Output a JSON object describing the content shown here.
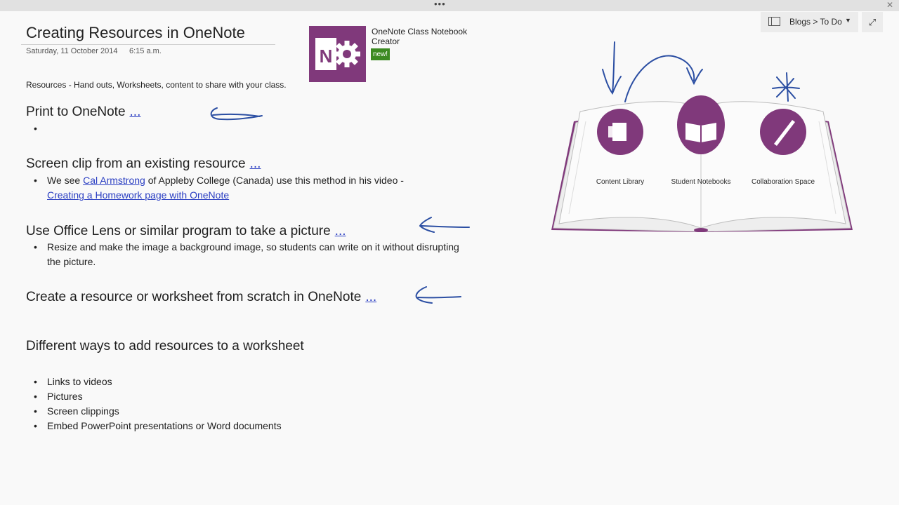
{
  "window": {
    "grip_glyph": "•••",
    "close_glyph": "✕"
  },
  "breadcrumb": {
    "text": "Blogs > To Do",
    "dropdown_glyph": "▼",
    "expand_glyph": "⤢"
  },
  "page": {
    "title": "Creating Resources in OneNote",
    "date": "Saturday, 11 October 2014",
    "time": "6:15 a.m."
  },
  "addin": {
    "caption": "OneNote Class Notebook Creator",
    "badge": "new!",
    "logo_letter": "N"
  },
  "intro": "Resources - Hand outs, Worksheets, content to share with your class.",
  "sections": [
    {
      "heading": "Print to OneNote",
      "more": "..."
    },
    {
      "heading": "Screen clip from an existing resource",
      "more": "...",
      "bullet": {
        "pre": "We see ",
        "link1": "Cal Armstrong",
        "mid": " of Appleby College (Canada) use this method in his video -",
        "link2": "Creating a Homework page with OneNote"
      }
    },
    {
      "heading": "Use Office Lens or similar program to take a picture",
      "more": "...",
      "bullet_line1": "Resize and make the image a background image, so students can write on it without disrupting",
      "bullet_line2": "the picture."
    },
    {
      "heading": "Create a resource or worksheet from scratch in OneNote",
      "more": "..."
    }
  ],
  "ways": {
    "heading": "Different ways to add resources to a worksheet",
    "items": [
      "Links to videos",
      "Pictures",
      "Screen clippings",
      "Embed PowerPoint presentations or Word documents"
    ]
  },
  "book": {
    "features": [
      "Content Library",
      "Student Notebooks",
      "Collaboration Space"
    ],
    "accent": "#80397b"
  },
  "colors": {
    "ink": "#2c4fa3",
    "link": "#2a3ec2",
    "badge": "#3c8a22"
  }
}
